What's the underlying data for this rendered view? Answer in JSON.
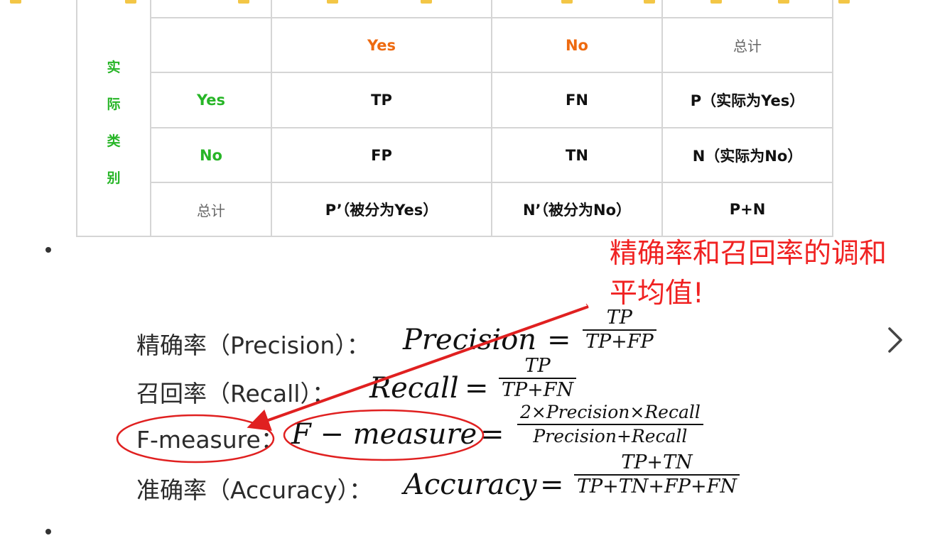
{
  "matrix": {
    "predicted_yes": "Yes",
    "predicted_no": "No",
    "total": "总计",
    "side_label": [
      "实",
      "际",
      "类",
      "别"
    ],
    "rows": [
      {
        "label": "Yes",
        "cells": [
          "TP",
          "FN",
          "P（实际为Yes）"
        ]
      },
      {
        "label": "No",
        "cells": [
          "FP",
          "TN",
          "N（实际为No）"
        ]
      },
      {
        "label": "总计",
        "cells": [
          "P’（被分为Yes）",
          "N’（被分为No）",
          "P+N"
        ]
      }
    ]
  },
  "annotation": {
    "line1": "精确率和召回率的调和",
    "line2": "平均值!"
  },
  "formulas": [
    {
      "label": "精确率（Precision）：",
      "lhs": "Precision",
      "eq": "=",
      "num": "TP",
      "den": "TP+FP"
    },
    {
      "label": "召回率（Recall）：",
      "lhs": "Recall",
      "eq": "=",
      "num": "TP",
      "den": "TP+FN"
    },
    {
      "label": "F-measure：",
      "lhs": "F − measure",
      "eq": "=",
      "num": "2×Precision×Recall",
      "den": "Precision+Recall"
    },
    {
      "label": "准确率（Accuracy）：",
      "lhs": "Accuracy",
      "eq": "=",
      "num": "TP+TN",
      "den": "TP+TN+FP+FN"
    }
  ],
  "nav": {
    "next_icon": "chevron-right-icon"
  },
  "colors": {
    "header_orange": "#ee6a10",
    "label_green": "#27b527",
    "annotation_red": "#f02222"
  }
}
